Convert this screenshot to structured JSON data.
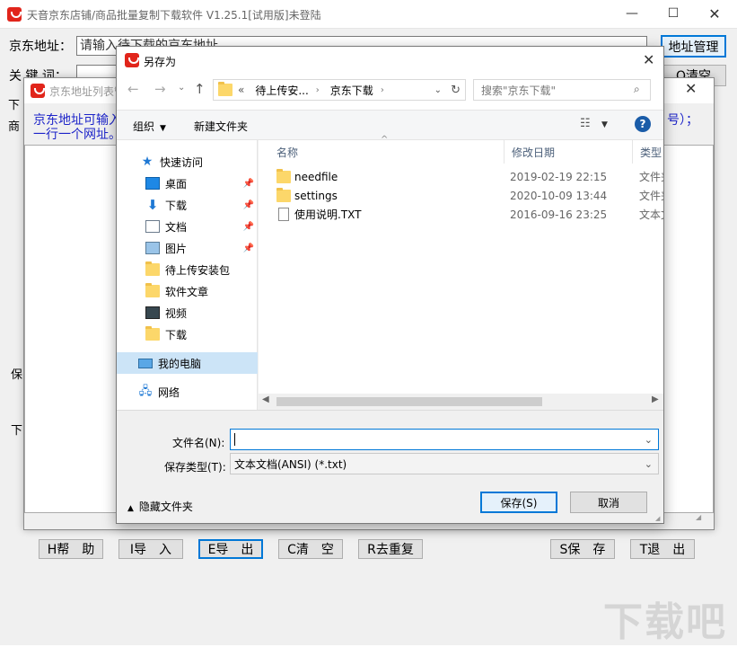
{
  "app": {
    "title": "天音京东店铺/商品批量复制下载软件 V1.25.1[试用版]未登陆",
    "min": "—",
    "max": "☐",
    "close": "✕"
  },
  "main": {
    "url_label": "京东地址：",
    "url_placeholder": "请输入待下载的京东地址",
    "addr_manage": "地址管理",
    "kw_label": "关 键 词：",
    "clear_btn": "Q清空",
    "side_chars": [
      "下",
      "商",
      "保",
      "下"
    ]
  },
  "list_dialog": {
    "title": "京东地址列表管理",
    "desc_line1": "京东地址可输入",
    "desc_line2": "一行一个网址。",
    "desc_tail": "号）；",
    "buttons": [
      "H帮　助",
      "I导　入",
      "E导　出",
      "C清　空",
      "R去重复",
      "S保　存",
      "T退　出"
    ]
  },
  "save_dialog": {
    "title": "另存为",
    "close": "✕",
    "path_prefix": "«",
    "path": [
      "待上传安...",
      "京东下载"
    ],
    "search_placeholder": "搜索\"京东下载\"",
    "organize": "组织",
    "new_folder": "新建文件夹",
    "help": "?",
    "nav_items": [
      {
        "label": "快速访问",
        "icon": "star-icon",
        "pinned": false
      },
      {
        "label": "桌面",
        "icon": "desktop-icon",
        "pinned": true
      },
      {
        "label": "下载",
        "icon": "download-icon",
        "pinned": true
      },
      {
        "label": "文档",
        "icon": "document-icon",
        "pinned": true
      },
      {
        "label": "图片",
        "icon": "picture-icon",
        "pinned": true
      },
      {
        "label": "待上传安装包",
        "icon": "folder-icon",
        "pinned": false
      },
      {
        "label": "软件文章",
        "icon": "folder-icon",
        "pinned": false
      },
      {
        "label": "视频",
        "icon": "video-icon",
        "pinned": false
      },
      {
        "label": "下载",
        "icon": "folder-icon",
        "pinned": false
      },
      {
        "label": "我的电脑",
        "icon": "computer-icon",
        "pinned": false
      },
      {
        "label": "网络",
        "icon": "network-icon",
        "pinned": false
      }
    ],
    "columns": [
      "名称",
      "修改日期",
      "类型"
    ],
    "files": [
      {
        "name": "needfile",
        "date": "2019-02-19 22:15",
        "type": "文件夹",
        "icon": "folder-icon"
      },
      {
        "name": "settings",
        "date": "2020-10-09 13:44",
        "type": "文件夹",
        "icon": "folder-icon"
      },
      {
        "name": "使用说明.TXT",
        "date": "2016-09-16 23:25",
        "type": "文本文档",
        "icon": "text-file-icon"
      }
    ],
    "filename_label": "文件名(N):",
    "filename_value": "",
    "filetype_label": "保存类型(T):",
    "filetype_value": "文本文档(ANSI) (*.txt)",
    "hide_folders": "隐藏文件夹",
    "save_btn": "保存(S)",
    "cancel_btn": "取消"
  },
  "watermark": "下载吧"
}
